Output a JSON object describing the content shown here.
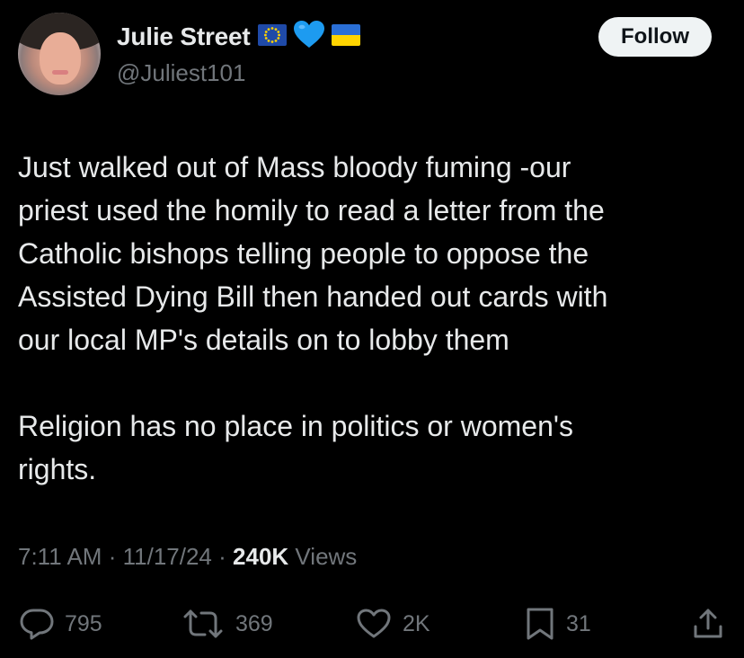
{
  "author": {
    "display_name": "Julie Street",
    "handle": "@Juliest101",
    "badges": [
      "eu-flag-icon",
      "blue-heart-icon",
      "ukraine-flag-icon"
    ]
  },
  "follow_button": {
    "label": "Follow"
  },
  "tweet": {
    "paragraph1_lines": [
      "Just walked out of Mass bloody fuming -our",
      "priest used the homily to read a letter from the",
      "Catholic bishops telling people to oppose the",
      "Assisted Dying Bill then handed out cards with",
      "our local MP's details on to lobby them"
    ],
    "paragraph2_lines": [
      "Religion has no place in politics or women's",
      "rights."
    ]
  },
  "meta": {
    "time": "7:11 AM",
    "separator": "·",
    "date": "11/17/24",
    "views_count": "240K",
    "views_label": "Views"
  },
  "actions": {
    "replies": "795",
    "reposts": "369",
    "likes": "2K",
    "bookmarks": "31"
  },
  "colors": {
    "background": "#000000",
    "text_primary": "#e7e9ea",
    "text_secondary": "#71767b",
    "follow_button_bg": "#eff3f4",
    "heart_blue": "#1d9bf0"
  }
}
